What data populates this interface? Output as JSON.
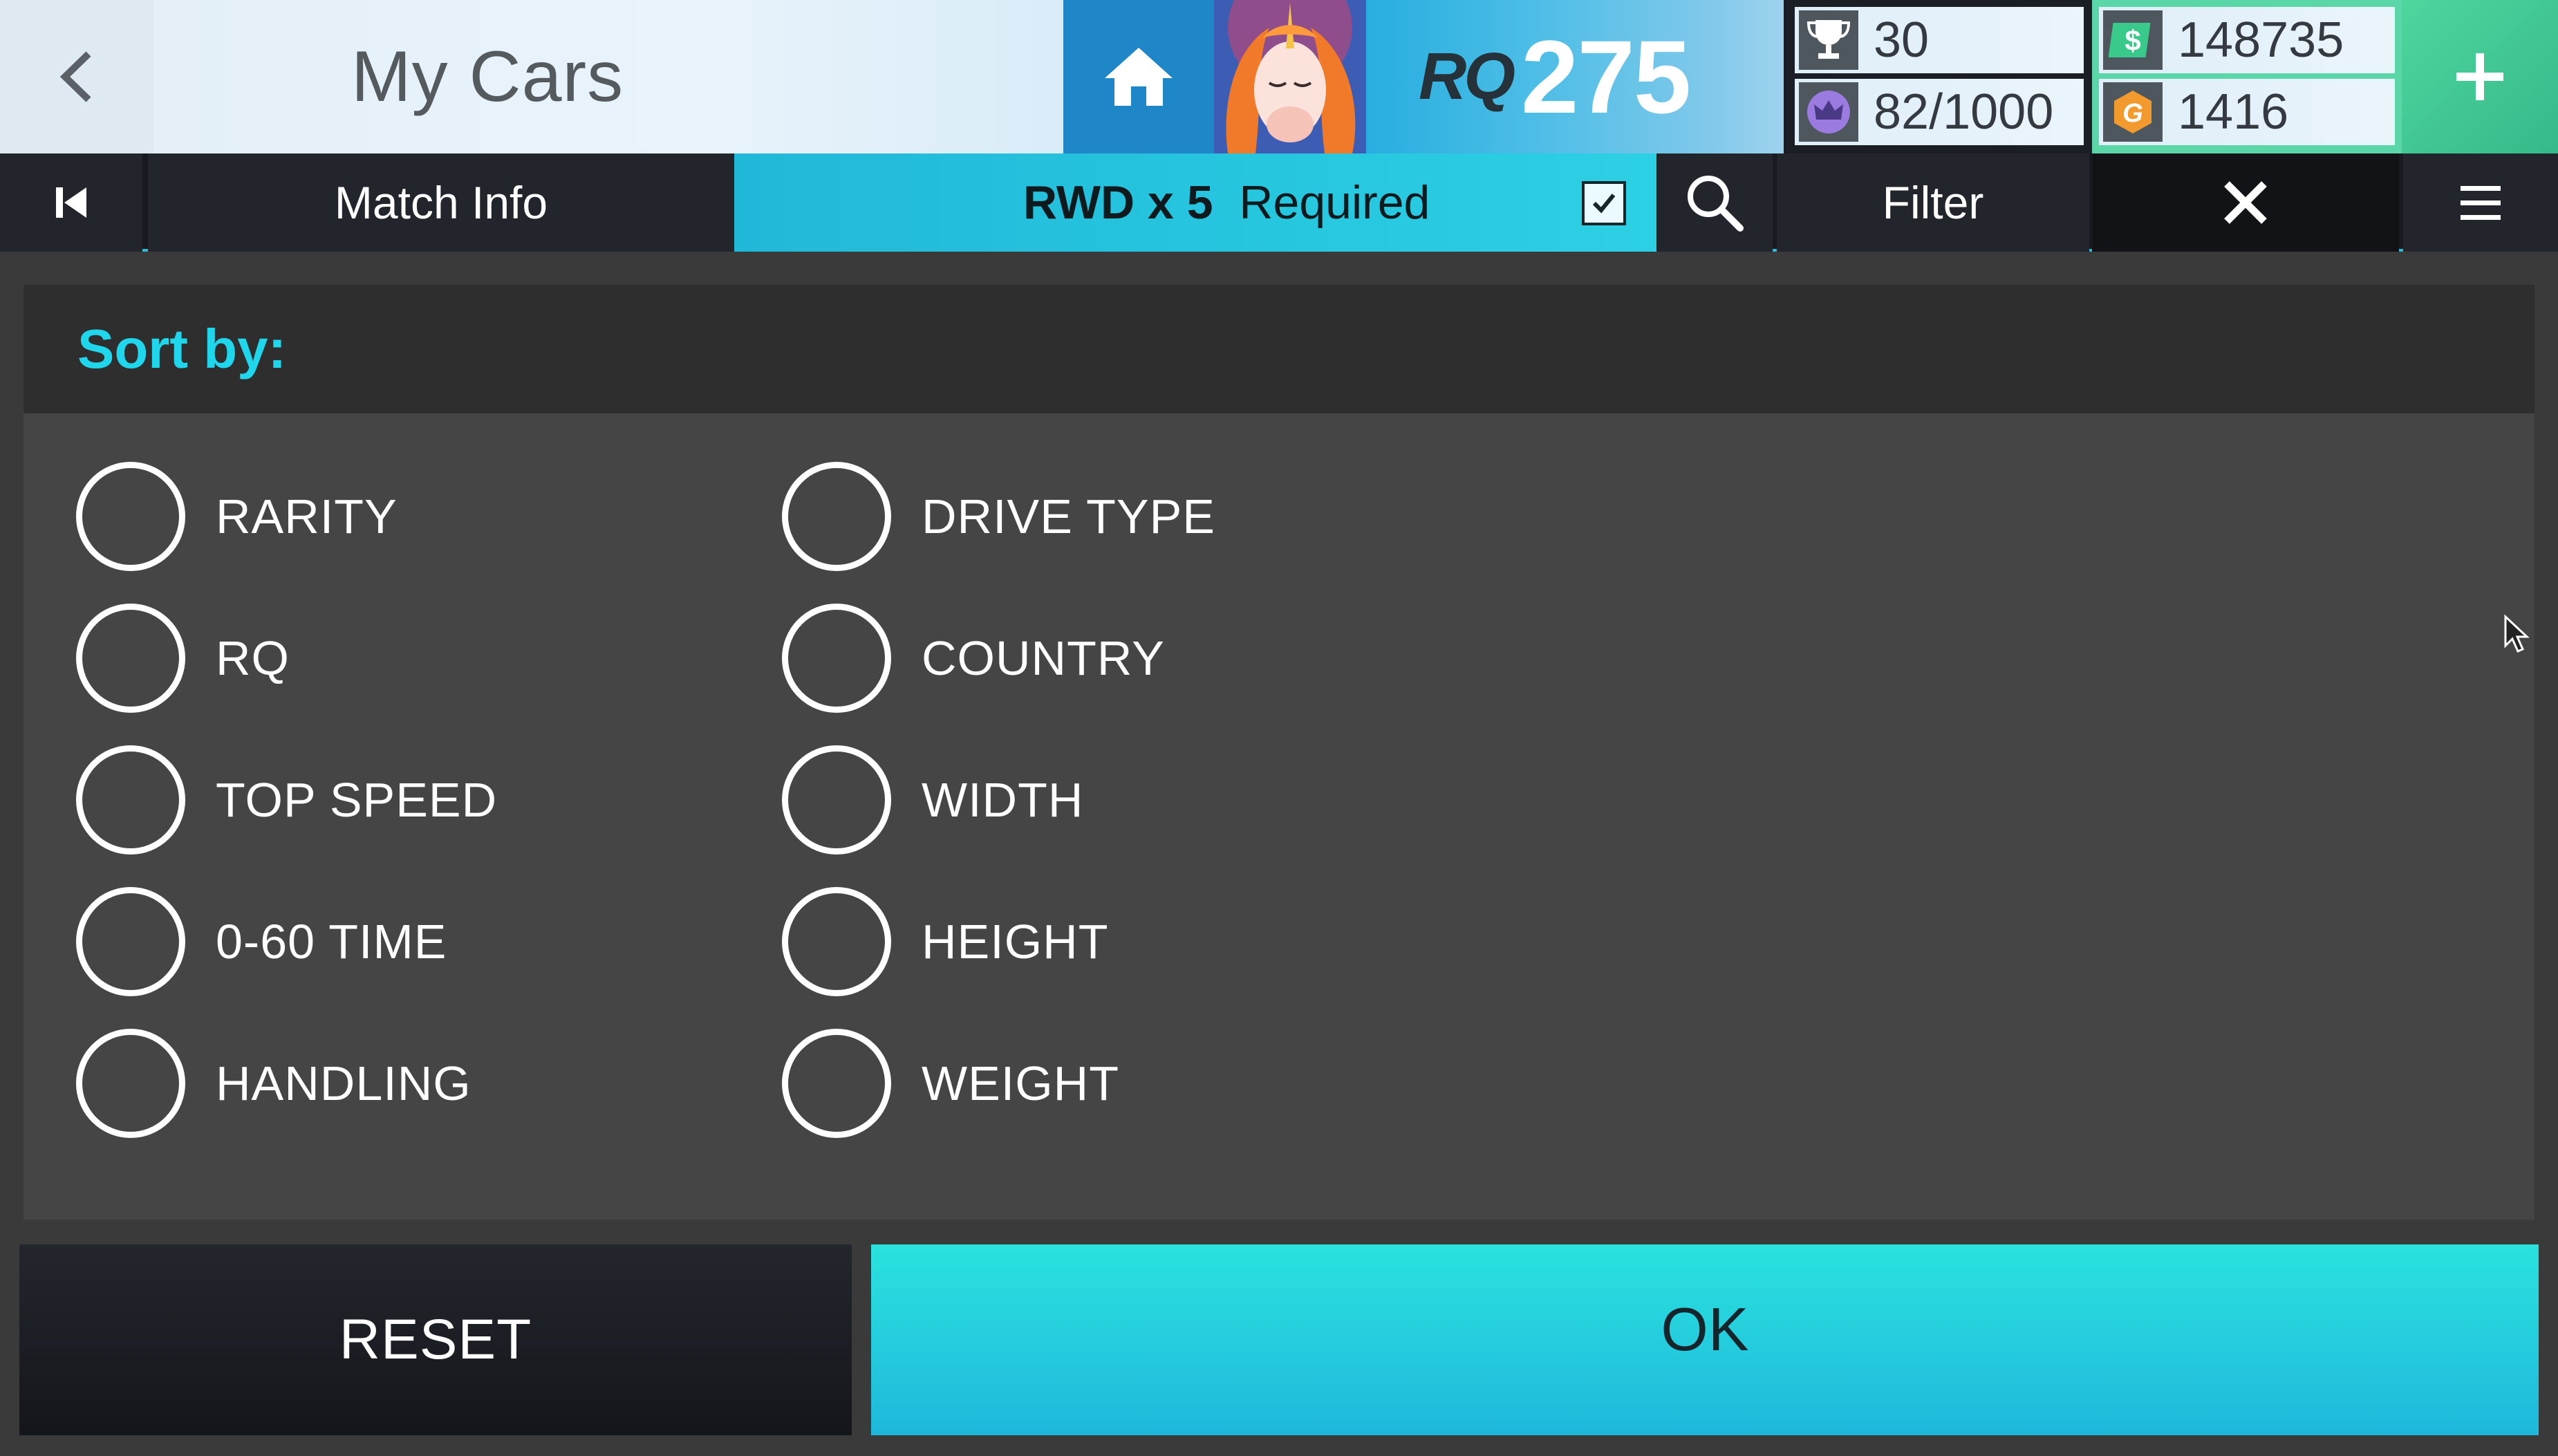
{
  "header": {
    "title": "My Cars",
    "rq_logo": "RQ",
    "rq_value": "275",
    "trophies": "30",
    "crowns": "82/1000",
    "cash": "148735",
    "gold": "1416"
  },
  "subbar": {
    "match_info": "Match Info",
    "requirement_count": "RWD x 5",
    "requirement_label": "Required",
    "filter": "Filter"
  },
  "sort": {
    "label": "Sort by:",
    "options_left": [
      "RARITY",
      "RQ",
      "TOP SPEED",
      "0-60 TIME",
      "HANDLING"
    ],
    "options_right": [
      "DRIVE TYPE",
      "COUNTRY",
      "WIDTH",
      "HEIGHT",
      "WEIGHT"
    ]
  },
  "buttons": {
    "reset": "RESET",
    "ok": "OK"
  },
  "colors": {
    "accent_cyan": "#1fd6ec",
    "ok_button": "#2ae2de",
    "home_blue": "#1f86c8",
    "currency_green": "#5ad6a8"
  }
}
